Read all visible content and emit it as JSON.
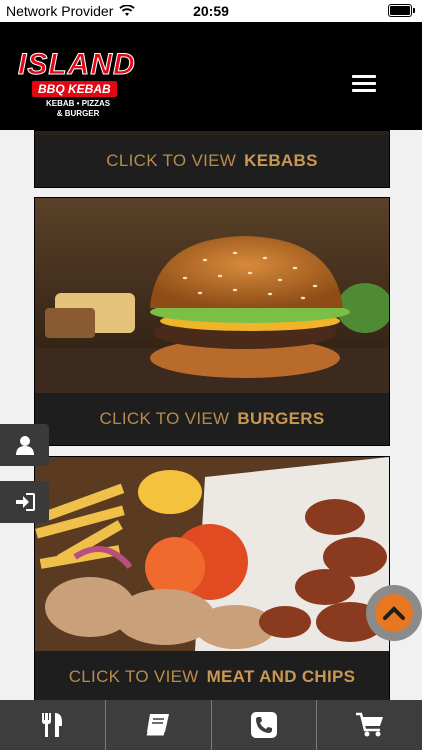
{
  "statusbar": {
    "carrier": "Network Provider",
    "time": "20:59"
  },
  "header": {
    "logo": {
      "main": "ISLAND",
      "sub": "BBQ KEBAB",
      "tagline_1": "KEBAB • PIZZAS",
      "tagline_2": "& BURGER"
    }
  },
  "cards": [
    {
      "prefix": "CLICK TO VIEW",
      "name": "KEBABS"
    },
    {
      "prefix": "CLICK TO VIEW",
      "name": "BURGERS"
    },
    {
      "prefix": "CLICK TO VIEW",
      "name": "MEAT AND CHIPS"
    }
  ],
  "colors": {
    "accent": "#c99752",
    "brand_red": "#e30613",
    "scroll_orange": "#e87722"
  },
  "icons": {
    "side_tabs": [
      "user-icon",
      "sign-in-icon"
    ],
    "bottom_bar": [
      "menu-food-icon",
      "book-icon",
      "phone-icon",
      "cart-icon"
    ]
  }
}
